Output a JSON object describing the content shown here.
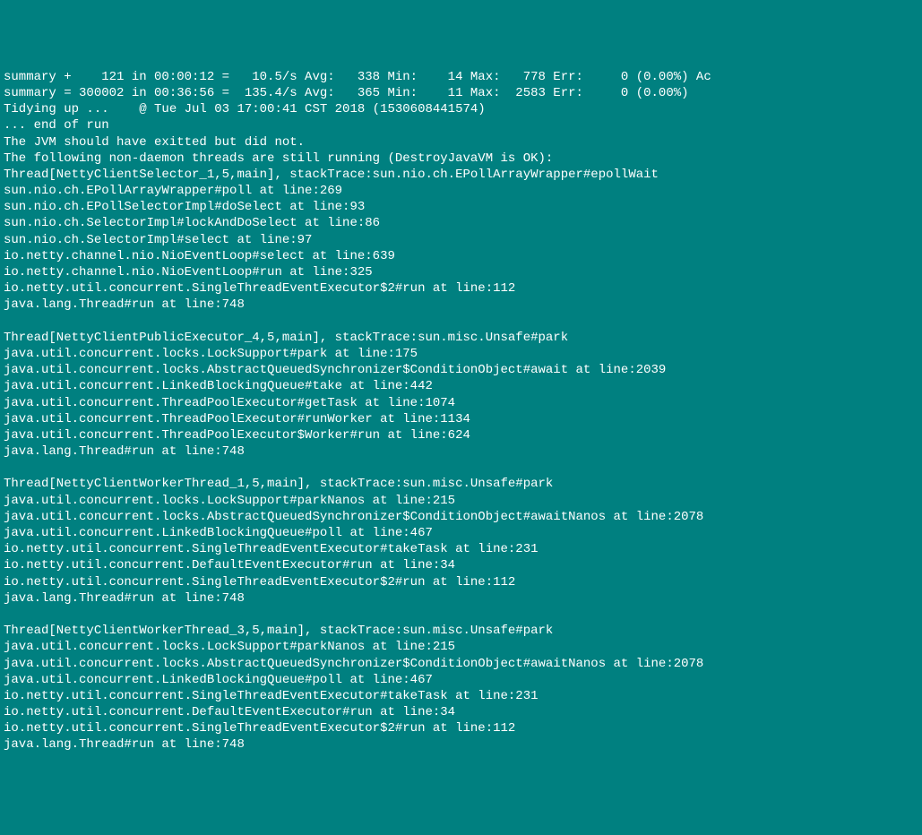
{
  "lines": [
    "summary +    121 in 00:00:12 =   10.5/s Avg:   338 Min:    14 Max:   778 Err:     0 (0.00%) Ac",
    "summary = 300002 in 00:36:56 =  135.4/s Avg:   365 Min:    11 Max:  2583 Err:     0 (0.00%)",
    "Tidying up ...    @ Tue Jul 03 17:00:41 CST 2018 (1530608441574)",
    "... end of run",
    "The JVM should have exitted but did not.",
    "The following non-daemon threads are still running (DestroyJavaVM is OK):",
    "Thread[NettyClientSelector_1,5,main], stackTrace:sun.nio.ch.EPollArrayWrapper#epollWait",
    "sun.nio.ch.EPollArrayWrapper#poll at line:269",
    "sun.nio.ch.EPollSelectorImpl#doSelect at line:93",
    "sun.nio.ch.SelectorImpl#lockAndDoSelect at line:86",
    "sun.nio.ch.SelectorImpl#select at line:97",
    "io.netty.channel.nio.NioEventLoop#select at line:639",
    "io.netty.channel.nio.NioEventLoop#run at line:325",
    "io.netty.util.concurrent.SingleThreadEventExecutor$2#run at line:112",
    "java.lang.Thread#run at line:748",
    "",
    "Thread[NettyClientPublicExecutor_4,5,main], stackTrace:sun.misc.Unsafe#park",
    "java.util.concurrent.locks.LockSupport#park at line:175",
    "java.util.concurrent.locks.AbstractQueuedSynchronizer$ConditionObject#await at line:2039",
    "java.util.concurrent.LinkedBlockingQueue#take at line:442",
    "java.util.concurrent.ThreadPoolExecutor#getTask at line:1074",
    "java.util.concurrent.ThreadPoolExecutor#runWorker at line:1134",
    "java.util.concurrent.ThreadPoolExecutor$Worker#run at line:624",
    "java.lang.Thread#run at line:748",
    "",
    "Thread[NettyClientWorkerThread_1,5,main], stackTrace:sun.misc.Unsafe#park",
    "java.util.concurrent.locks.LockSupport#parkNanos at line:215",
    "java.util.concurrent.locks.AbstractQueuedSynchronizer$ConditionObject#awaitNanos at line:2078",
    "java.util.concurrent.LinkedBlockingQueue#poll at line:467",
    "io.netty.util.concurrent.SingleThreadEventExecutor#takeTask at line:231",
    "io.netty.util.concurrent.DefaultEventExecutor#run at line:34",
    "io.netty.util.concurrent.SingleThreadEventExecutor$2#run at line:112",
    "java.lang.Thread#run at line:748",
    "",
    "Thread[NettyClientWorkerThread_3,5,main], stackTrace:sun.misc.Unsafe#park",
    "java.util.concurrent.locks.LockSupport#parkNanos at line:215",
    "java.util.concurrent.locks.AbstractQueuedSynchronizer$ConditionObject#awaitNanos at line:2078",
    "java.util.concurrent.LinkedBlockingQueue#poll at line:467",
    "io.netty.util.concurrent.SingleThreadEventExecutor#takeTask at line:231",
    "io.netty.util.concurrent.DefaultEventExecutor#run at line:34",
    "io.netty.util.concurrent.SingleThreadEventExecutor$2#run at line:112",
    "java.lang.Thread#run at line:748"
  ]
}
